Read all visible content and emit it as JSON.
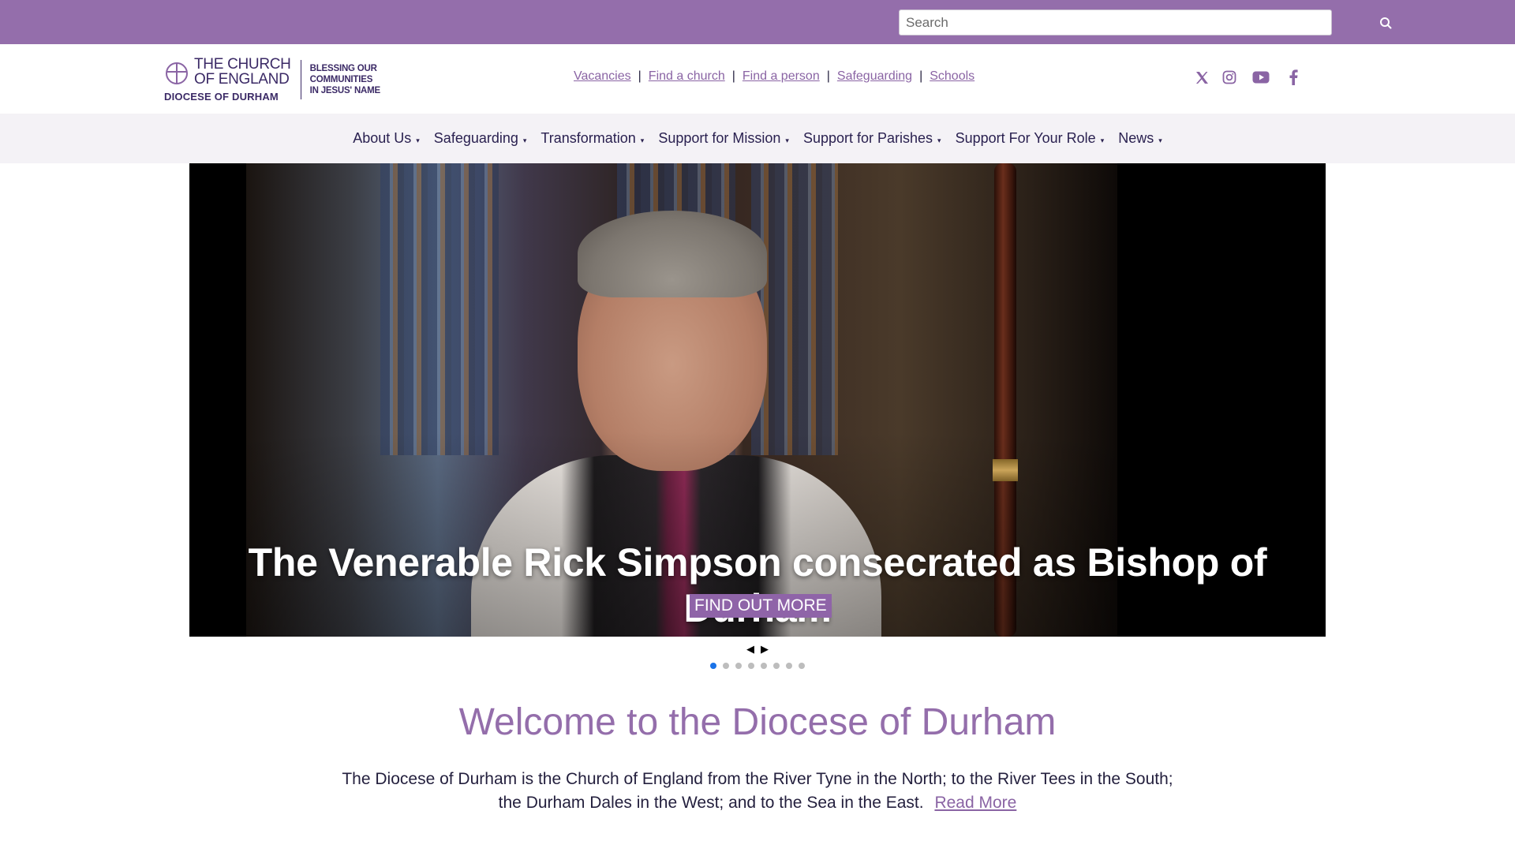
{
  "search": {
    "placeholder": "Search"
  },
  "logo": {
    "name_line1": "THE CHURCH",
    "name_line2": "OF ENGLAND",
    "diocese": "DIOCESE OF DURHAM",
    "tagline1": "BLESSING OUR",
    "tagline2": "COMMUNITIES",
    "tagline3": "IN JESUS' NAME"
  },
  "util_links": {
    "vacancies": "Vacancies",
    "find_church": "Find a church",
    "find_person": "Find a person",
    "safeguarding": "Safeguarding",
    "schools": "Schools",
    "separator": "|"
  },
  "social": {
    "icons": [
      "x-icon",
      "instagram-icon",
      "youtube-icon",
      "facebook-icon"
    ],
    "color": "#8a64a4"
  },
  "nav": {
    "items": [
      {
        "label": "About Us"
      },
      {
        "label": "Safeguarding"
      },
      {
        "label": "Transformation"
      },
      {
        "label": "Support for Mission"
      },
      {
        "label": "Support for Parishes"
      },
      {
        "label": "Support For Your Role"
      },
      {
        "label": "News"
      }
    ],
    "caret": "▾"
  },
  "hero": {
    "title": "The Venerable Rick Simpson consecrated as Bishop of Durham",
    "cta": "FIND OUT MORE",
    "prev": "◀",
    "next": "▶",
    "slide_count": 8,
    "active_slide": 1
  },
  "welcome": {
    "title": "Welcome to the Diocese of Durham",
    "text": "The Diocese of Durham is the Church of England from the River Tyne in the North; to the River Tees in the South; the Durham Dales in the West; and to the Sea in the East.",
    "read_more": "Read More"
  },
  "colors": {
    "brand_purple": "#946eab",
    "nav_bg": "#f4f2f6",
    "nav_text": "#2a2150",
    "dot_active": "#1a73e8"
  }
}
